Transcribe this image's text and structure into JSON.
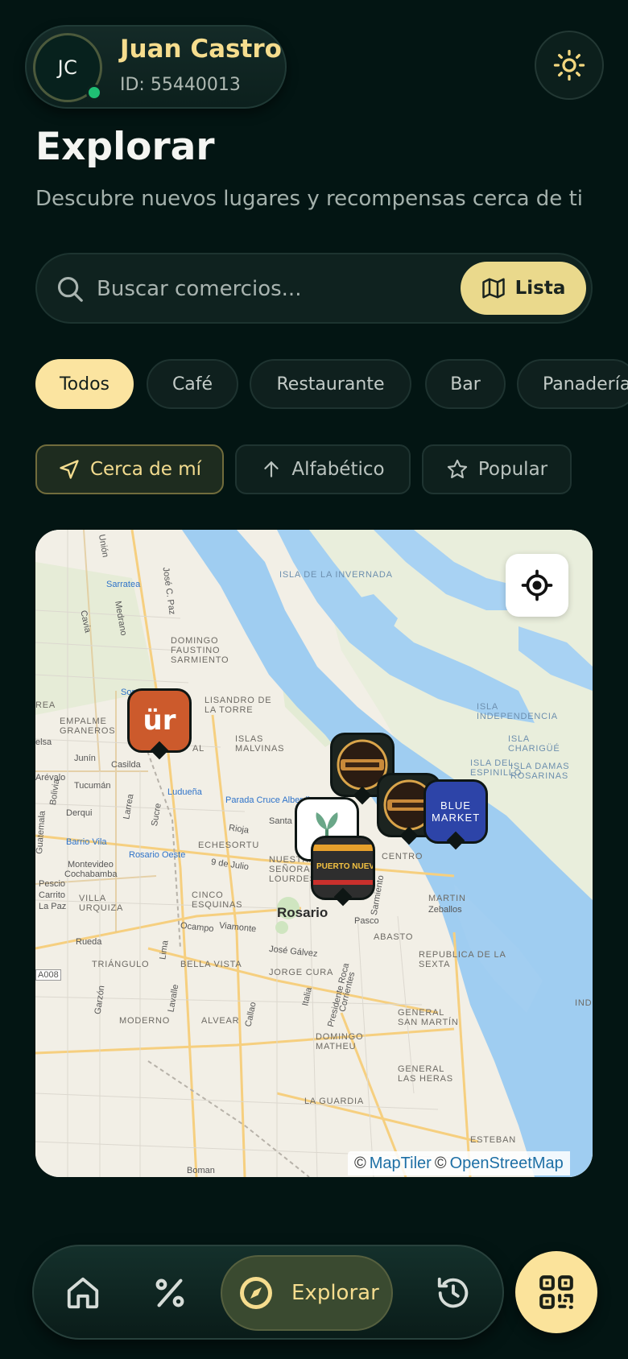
{
  "header": {
    "avatar_initials": "JC",
    "user_name": "Juan Castro",
    "user_id": "ID: 55440013",
    "theme_icon": "sun-icon"
  },
  "page": {
    "title": "Explorar",
    "subtitle": "Descubre nuevos lugares y recompensas cerca de ti"
  },
  "search": {
    "placeholder": "Buscar comercios...",
    "value": "",
    "view_toggle_label": "Lista",
    "view_toggle_icon": "map-icon"
  },
  "categories": [
    {
      "label": "Todos",
      "active": true
    },
    {
      "label": "Café",
      "active": false
    },
    {
      "label": "Restaurante",
      "active": false
    },
    {
      "label": "Bar",
      "active": false
    },
    {
      "label": "Panadería",
      "active": false
    }
  ],
  "sort": [
    {
      "label": "Cerca de mí",
      "icon": "navigation-arrow-icon",
      "active": true
    },
    {
      "label": "Alfabético",
      "icon": "arrow-up-icon",
      "active": false
    },
    {
      "label": "Popular",
      "icon": "star-icon",
      "active": false
    }
  ],
  "map": {
    "labels": {
      "city": "Rosario",
      "isla_invernada": "ISLA DE LA INVERNADA",
      "domingo_sarmiento": "DOMINGO FAUSTINO SARMIENTO",
      "lisandro": "LISANDRO DE LA TORRE",
      "empalme": "EMPALME GRANEROS",
      "islas_malvinas": "ISLAS MALVINAS",
      "isla_independencia": "ISLA INDEPENDENCIA",
      "isla_chirigue": "ISLA CHARIGÜÉ",
      "isla_del_espinillo": "ISLA DEL ESPINILLO",
      "isla_damas": "ISLA DAMAS ROSARINAS",
      "echesortu": "ECHESORTU",
      "nuestra_senora": "NUESTRA SEÑORA DE LOURDES",
      "centro": "CENTRO",
      "cinco_esquinas": "CINCO ESQUINAS",
      "villa_urquiza": "VILLA URQUIZA",
      "abasto": "ABASTO",
      "martin": "MARTIN",
      "republica": "REPUBLICA DE LA SEXTA",
      "triangulo": "TRIÁNGULO",
      "bella_vista": "BELLA VISTA",
      "jorge_cura": "JORGE CURA",
      "moderno": "MODERNO",
      "alvear": "ALVEAR",
      "domingo_matheu": "DOMINGO MATHEU",
      "general_san_martin": "GENERAL SAN MARTÍN",
      "general_las_heras": "GENERAL LAS HERAS",
      "la_guardia": "LA GUARDIA",
      "area": "REA",
      "lal": "AL",
      "esteban": "ESTEBAN",
      "s_ind": "IND"
    },
    "stations": [
      "Sarratea",
      "Sorrento",
      "Ludueña",
      "Parada Cruce Alberdi",
      "Barrio Vila",
      "Rosario Oeste"
    ],
    "streets": [
      "Unión",
      "José C. Paz",
      "Medrano",
      "Cavia",
      "Junín",
      "Casilda",
      "Tucumán",
      "Arévalo",
      "Bolivia",
      "Derqui",
      "Larrea",
      "Sucre",
      "Guatemala",
      "Montevideo",
      "Cochabamba",
      "Pescio",
      "Carrito",
      "La Paz",
      "Rioja",
      "Santa Fe",
      "9 de Julio",
      "Ocampo",
      "Viamonte",
      "José Gálvez",
      "Pasco",
      "Zeballos",
      "Sarmiento",
      "Rueda",
      "Lima",
      "Garzón",
      "Lavalle",
      "Callao",
      "Italia",
      "Presidente Roca",
      "Corrientes",
      "Boman",
      "A008",
      "elsa"
    ],
    "attribution": [
      "©",
      "MapTiler",
      "©",
      "OpenStreetMap"
    ],
    "markers": [
      {
        "name": "ur-marker",
        "label": "ür",
        "bg": "#cc5a2c"
      },
      {
        "name": "pin-bar-logo-1",
        "label": "",
        "bg": "#1c2420"
      },
      {
        "name": "pin-bar-logo-2",
        "label": "",
        "bg": "#1c2420"
      },
      {
        "name": "pin-leaf-logo",
        "label": "",
        "bg": "#ffffff"
      },
      {
        "name": "puerto-nuevo-marker",
        "label": "PUERTO NUEVO",
        "bg": "#2a2a2a"
      },
      {
        "name": "blue-market-marker",
        "label": "BLUE MARKET",
        "bg": "#2d44a8"
      }
    ],
    "locate_icon": "crosshair-icon"
  },
  "nav": {
    "items": [
      {
        "icon": "home-icon"
      },
      {
        "icon": "percent-icon"
      },
      {
        "icon": "compass-icon",
        "label": "Explorar",
        "active": true
      },
      {
        "icon": "history-icon"
      }
    ],
    "qr_icon": "qr-code-icon"
  },
  "colors": {
    "background": "#031513",
    "accent": "#fbe39b",
    "accent_text": "#f6dd8e",
    "online": "#1fbf74"
  }
}
